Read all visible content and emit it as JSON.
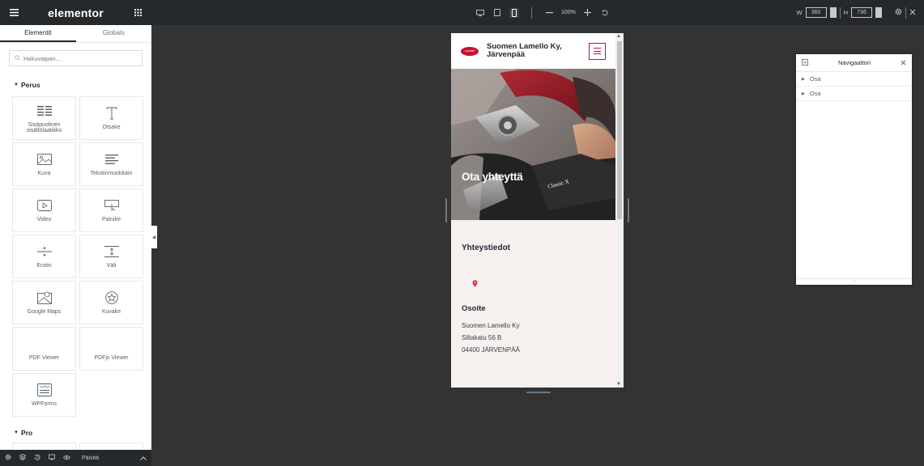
{
  "panel": {
    "logo": "elementor",
    "tabs": [
      "Elementit",
      "Globals"
    ],
    "search_placeholder": "Hakuvaipan...",
    "category_perus": "Perus",
    "category_pro": "Pro",
    "widgets": [
      {
        "label": "Sisäpuolinen sisältölaatikko",
        "icon": "inner-section-icon"
      },
      {
        "label": "Otsake",
        "icon": "heading-icon"
      },
      {
        "label": "Kuva",
        "icon": "image-icon"
      },
      {
        "label": "Tekstinmuokkain",
        "icon": "text-editor-icon"
      },
      {
        "label": "Video",
        "icon": "video-icon"
      },
      {
        "label": "Painike",
        "icon": "button-icon"
      },
      {
        "label": "Erotin",
        "icon": "divider-icon"
      },
      {
        "label": "Väli",
        "icon": "spacer-icon"
      },
      {
        "label": "Google Maps",
        "icon": "map-icon"
      },
      {
        "label": "Kuvake",
        "icon": "star-icon"
      },
      {
        "label": "PDF Viewer",
        "icon": ""
      },
      {
        "label": "PDFjs Viewer",
        "icon": ""
      },
      {
        "label": "WPForms",
        "icon": "wpforms-icon"
      }
    ],
    "footer_publish": "Päivitä"
  },
  "topbar": {
    "zoom": "100%",
    "width_label": "W",
    "width_value": "360",
    "height_label": "H",
    "height_value": "736"
  },
  "preview": {
    "site_title": "Suomen Lamello Ky, Järvenpää",
    "logo_text": "Lamello",
    "hero_title": "Ota yhteyttä",
    "machine_label": "Classic X",
    "contact_heading": "Yhteystiedot",
    "address_heading": "Osoite",
    "address_lines": [
      "Suomen Lamello Ky",
      "Siltakatu 56 B",
      "04400 JÄRVENPÄÄ"
    ]
  },
  "navigator": {
    "title": "Navigaattori",
    "items": [
      "Osa",
      "Osa"
    ],
    "footer": "..."
  },
  "colors": {
    "accent": "#c8102e",
    "panel_dark": "#26292c",
    "canvas_bg": "#333333",
    "contact_bg": "#f6f0ef"
  }
}
